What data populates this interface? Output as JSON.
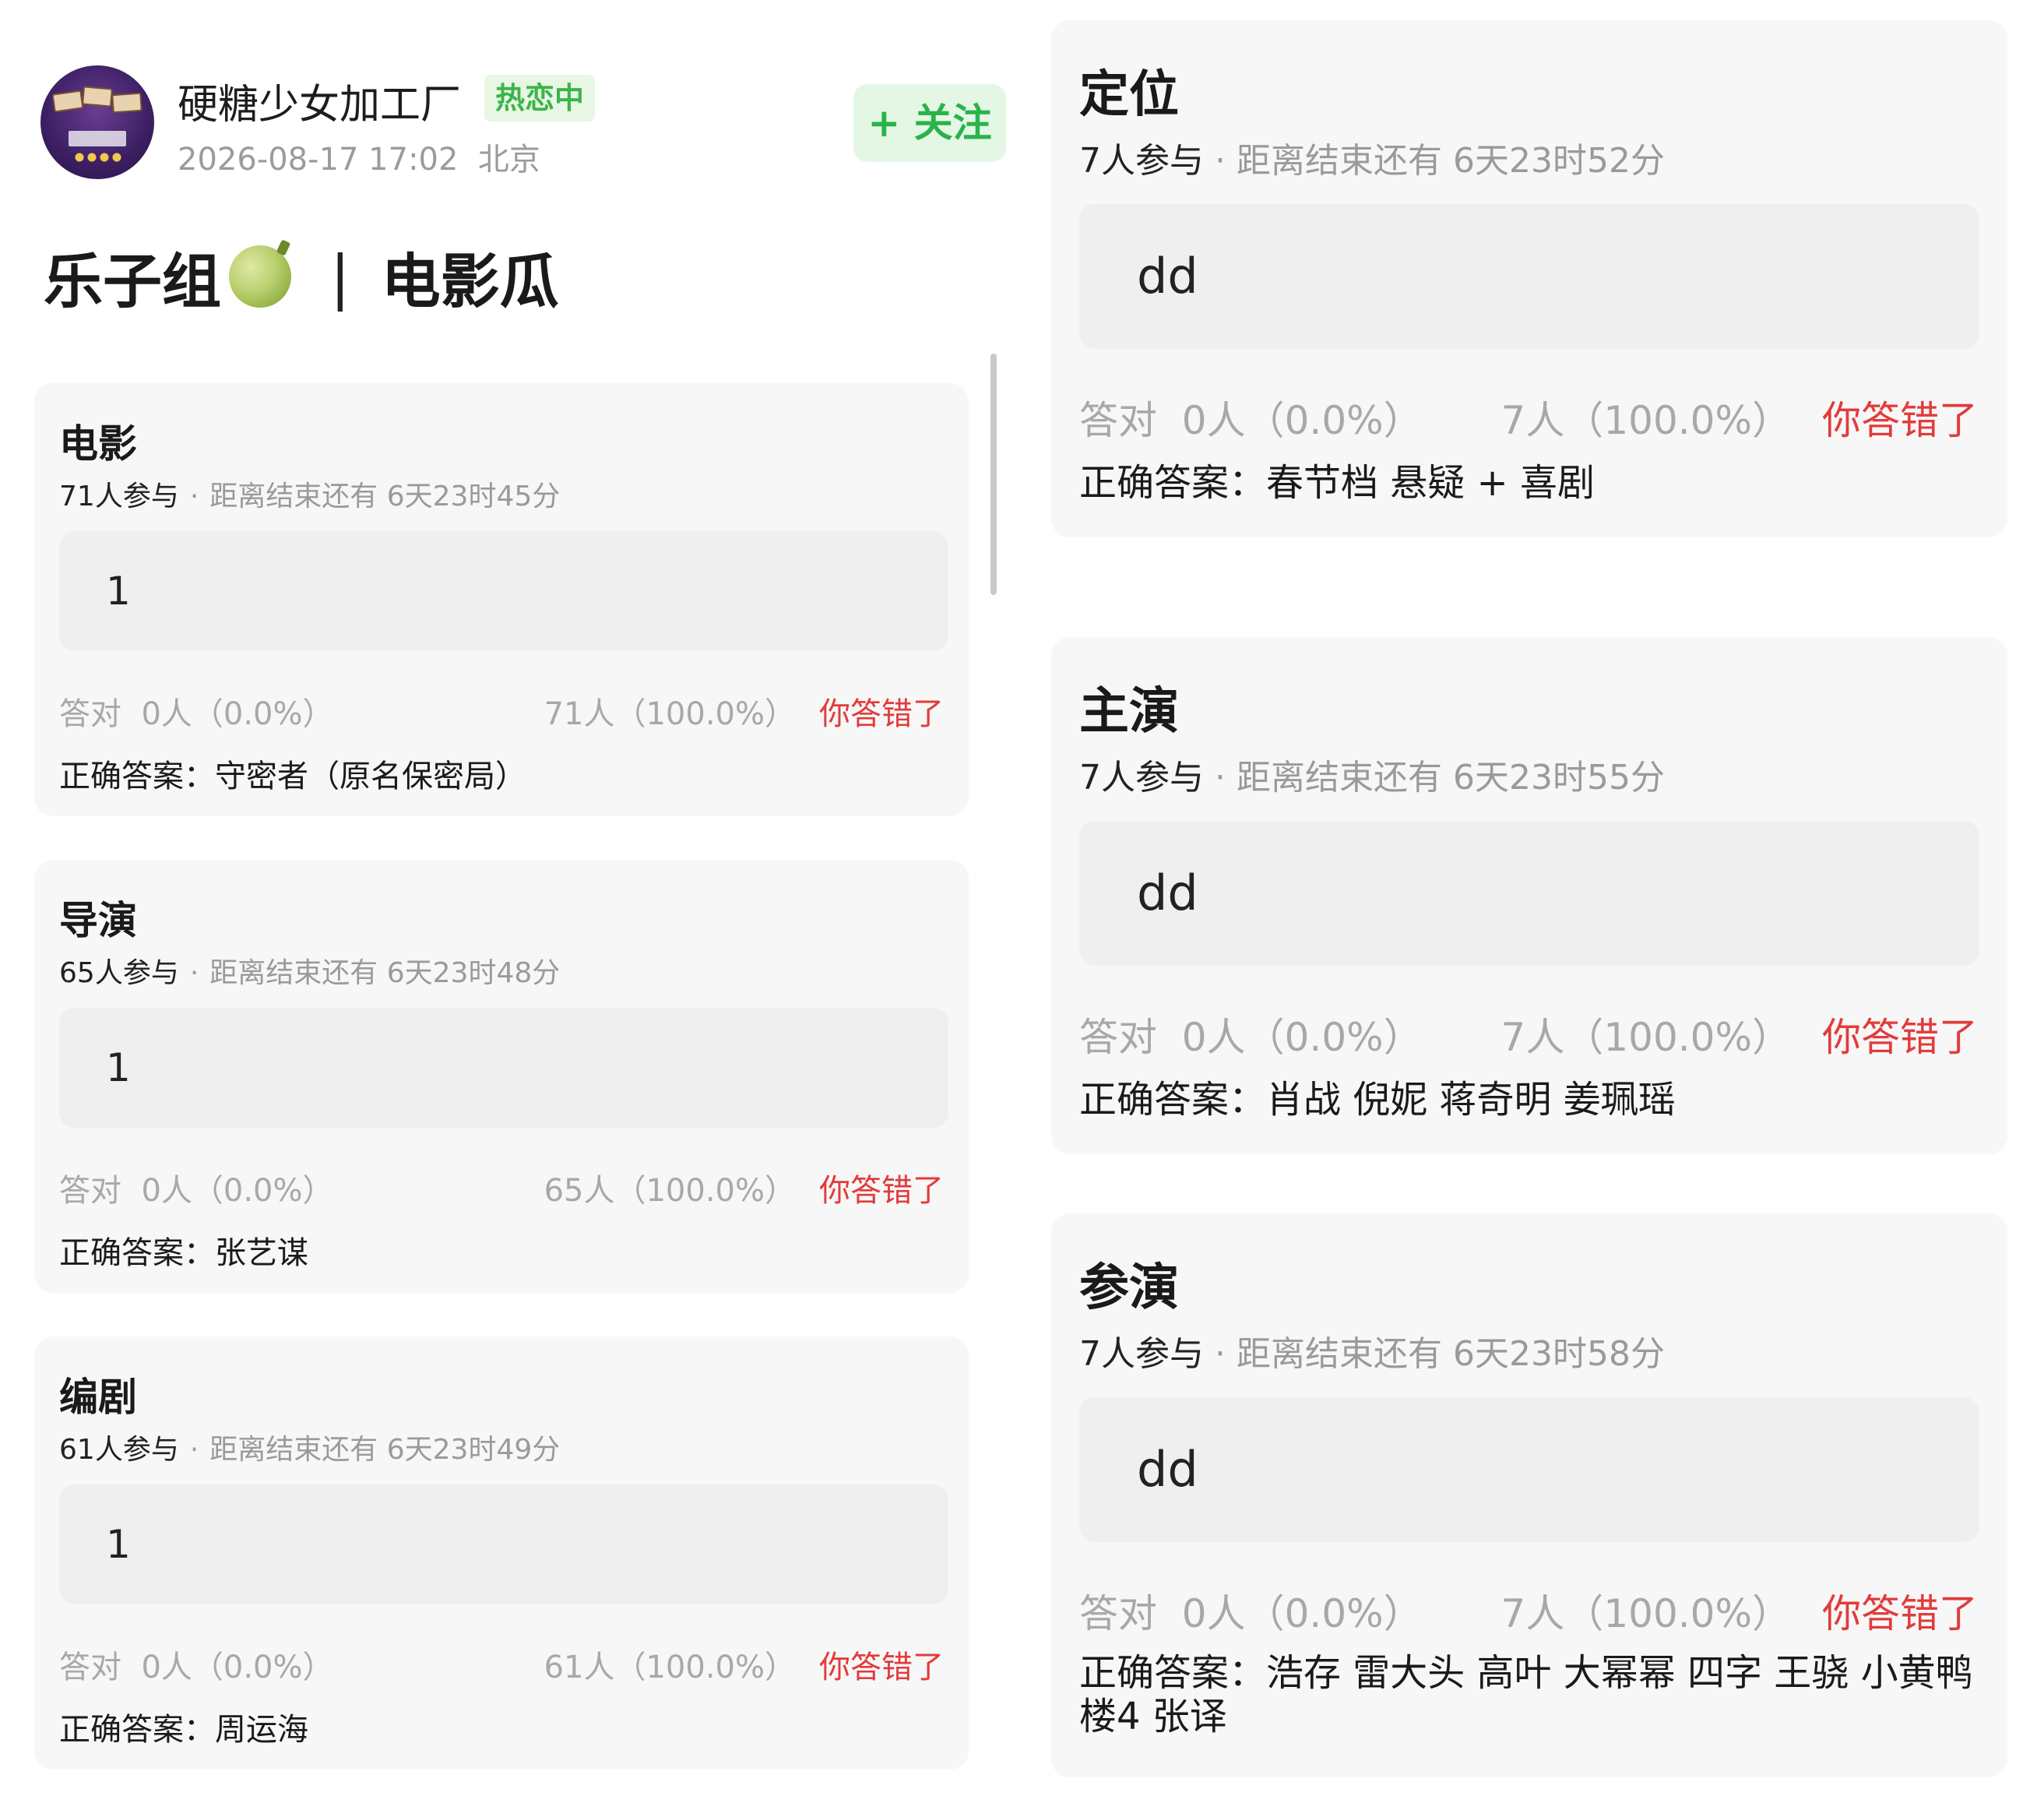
{
  "header": {
    "username": "硬糖少女加工厂",
    "hot_badge": "热恋中",
    "timestamp": "2026-08-17 17:02",
    "location": "北京",
    "follow_label": "+ 关注"
  },
  "post": {
    "title_part1": "乐子组",
    "title_separator": "|",
    "title_part2": "电影瓜",
    "icon": "melon-icon"
  },
  "labels": {
    "participants_suffix": "人参与",
    "dot": "·",
    "time_left_prefix": "距离结束还有",
    "correct_prefix": "答对",
    "answer_prefix": "正确答案："
  },
  "quizzes_left": [
    {
      "title": "电影",
      "participants": "71",
      "time_left": "6天23时45分",
      "option": "1",
      "correct_stat": "0人（0.0%）",
      "option_stat": "71人（100.0%）",
      "status": "你答错了",
      "answer": "守密者（原名保密局）"
    },
    {
      "title": "导演",
      "participants": "65",
      "time_left": "6天23时48分",
      "option": "1",
      "correct_stat": "0人（0.0%）",
      "option_stat": "65人（100.0%）",
      "status": "你答错了",
      "answer": "张艺谋"
    },
    {
      "title": "编剧",
      "participants": "61",
      "time_left": "6天23时49分",
      "option": "1",
      "correct_stat": "0人（0.0%）",
      "option_stat": "61人（100.0%）",
      "status": "你答错了",
      "answer": "周运海"
    }
  ],
  "quizzes_right": [
    {
      "title": "定位",
      "participants": "7",
      "time_left": "6天23时52分",
      "option": "dd",
      "correct_stat": "0人（0.0%）",
      "option_stat": "7人（100.0%）",
      "status": "你答错了",
      "answer": "春节档 悬疑 + 喜剧"
    },
    {
      "title": "主演",
      "participants": "7",
      "time_left": "6天23时55分",
      "option": "dd",
      "correct_stat": "0人（0.0%）",
      "option_stat": "7人（100.0%）",
      "status": "你答错了",
      "answer": "肖战 倪妮 蒋奇明 姜珮瑶"
    },
    {
      "title": "参演",
      "participants": "7",
      "time_left": "6天23时58分",
      "option": "dd",
      "correct_stat": "0人（0.0%）",
      "option_stat": "7人（100.0%）",
      "status": "你答错了",
      "answer": "浩存 雷大头 高叶 大幂幂 四字 王骁 小黄鸭 楼4 张译"
    }
  ],
  "colors": {
    "accent_green": "#29b34a",
    "wrong_red": "#e23b3b",
    "card_bg": "#f7f7f7",
    "option_bg": "#efefef"
  }
}
